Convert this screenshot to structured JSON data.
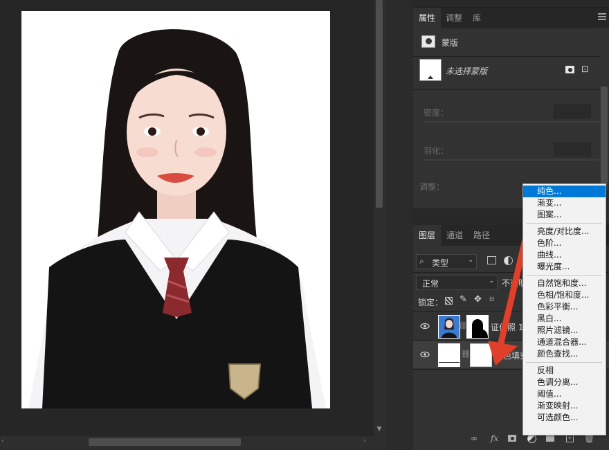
{
  "properties_panel": {
    "tabs": [
      {
        "label": "属性"
      },
      {
        "label": "调整"
      },
      {
        "label": "库"
      }
    ],
    "section_title": "蒙版",
    "mask_status": "未选择蒙版",
    "density_label": "密度：",
    "feather_label": "羽化：",
    "adjust_label": "调整："
  },
  "layers_panel": {
    "tabs": [
      {
        "label": "图层"
      },
      {
        "label": "通道"
      },
      {
        "label": "路径"
      }
    ],
    "filter_kind": "类型",
    "blend_mode": "正常",
    "opacity_label": "不透明",
    "lock_label": "锁定：",
    "layers": [
      {
        "name": "证件照 1"
      },
      {
        "name": "颜色填充 1"
      }
    ],
    "footer_icons": [
      "link-icon",
      "fx-icon",
      "mask-icon",
      "adjustment-icon",
      "group-icon",
      "new-layer-icon",
      "trash-icon"
    ]
  },
  "adjustment_menu": {
    "groups": [
      [
        "纯色...",
        "渐变...",
        "图案..."
      ],
      [
        "亮度/对比度...",
        "色阶...",
        "曲线...",
        "曝光度..."
      ],
      [
        "自然饱和度...",
        "色相/饱和度...",
        "色彩平衡...",
        "黑白...",
        "照片滤镜...",
        "通道混合器...",
        "颜色查找..."
      ],
      [
        "反相",
        "色调分离...",
        "阈值...",
        "渐变映射...",
        "可选颜色..."
      ]
    ],
    "selected": "纯色..."
  },
  "colors": {
    "menu_highlight": "#0078d7",
    "arrow": "#e0402a",
    "panel_bg": "#323232"
  }
}
